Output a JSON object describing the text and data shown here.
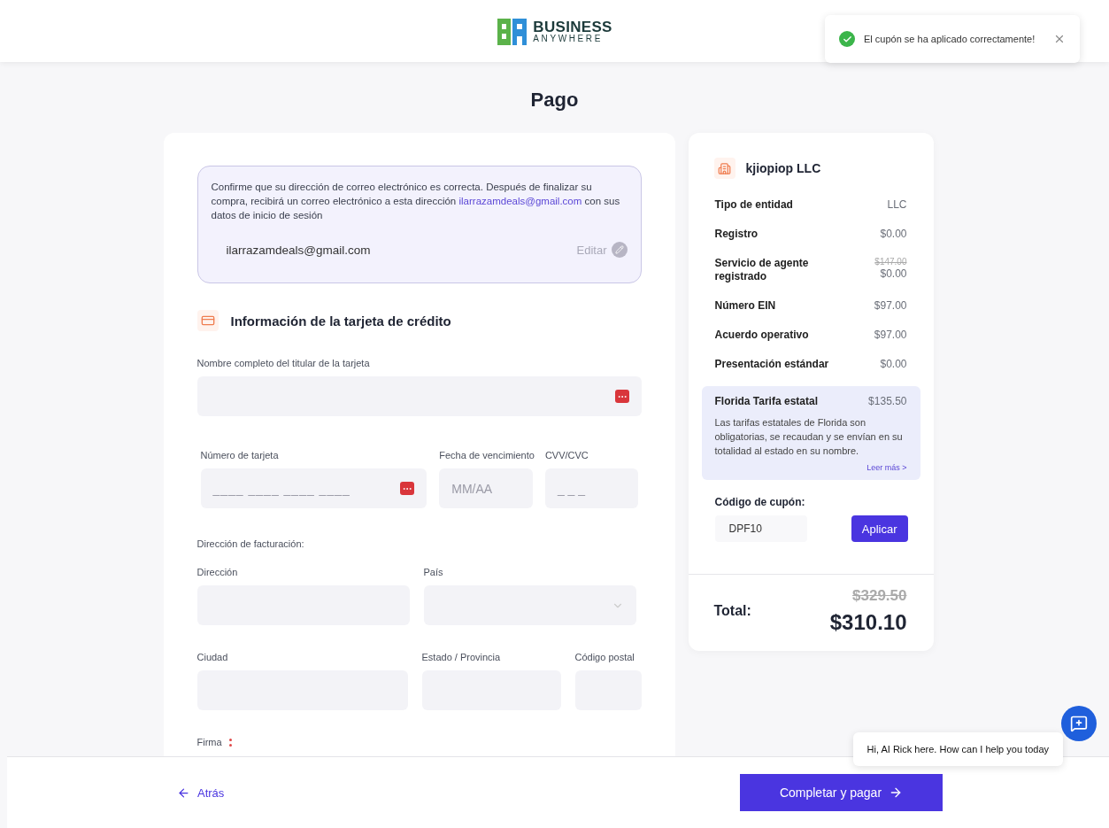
{
  "header": {
    "logo": {
      "line1": "BUSINESS",
      "line2": "ANYWHERE"
    }
  },
  "toast": {
    "kind": "success",
    "message": "El cupón se ha aplicado correctamente!"
  },
  "title": "Pago",
  "email_notice": {
    "text_before": "Confirme que su dirección de correo electrónico es correcta. Después de finalizar su compra, recibirá un correo electrónico a esta dirección",
    "link": "ilarrazamdeals@gmail.com",
    "text_after": "con sus datos de inicio de sesión",
    "email": "ilarrazamdeals@gmail.com",
    "edit_label": "Editar"
  },
  "card_section": {
    "title": "Información de la tarjeta de crédito",
    "holder": {
      "label": "Nombre completo del titular de la tarjeta"
    },
    "number": {
      "label": "Número de tarjeta",
      "placeholder": "____ ____ ____ ____"
    },
    "expiry": {
      "label": "Fecha de vencimiento",
      "placeholder": "MM/AA"
    },
    "cvv": {
      "label": "CVV/CVC",
      "placeholder": "_ _ _"
    }
  },
  "billing": {
    "title": "Dirección de facturación:",
    "rows": [
      [
        {
          "label": "Dirección",
          "kind": "text"
        },
        {
          "label": "País",
          "kind": "select"
        }
      ],
      [
        {
          "label": "Ciudad",
          "kind": "text"
        },
        {
          "label": "Estado / Provincia",
          "kind": "text"
        },
        {
          "label": "Código postal",
          "kind": "text"
        }
      ]
    ],
    "signature_label": "Firma"
  },
  "summary": {
    "company": "kjiopiop LLC",
    "items": [
      {
        "label": "Tipo de entidad",
        "value": "LLC"
      },
      {
        "label": "Registro",
        "value": "$0.00"
      },
      {
        "label": "Servicio de agente registrado",
        "old_value": "$147.00",
        "value": "$0.00"
      },
      {
        "label": "Número EIN",
        "value": "$97.00"
      },
      {
        "label": "Acuerdo operativo",
        "value": "$97.00"
      },
      {
        "label": "Presentación estándar",
        "value": "$0.00"
      }
    ],
    "state_fee": {
      "label": "Florida Tarifa estatal",
      "value": "$135.50",
      "description": "Las tarifas estatales de Florida son obligatorias, se recaudan y se envían en su totalidad al estado en su nombre.",
      "link": "Leer más >"
    },
    "coupon": {
      "label": "Código de cupón:",
      "value": "DPF10",
      "button": "Aplicar"
    },
    "total": {
      "label": "Total:",
      "old_value": "$329.50",
      "value": "$310.10"
    }
  },
  "footer": {
    "back": "Atrás",
    "submit": "Completar y pagar"
  },
  "chat": {
    "message": "Hi, AI Rick here. How can I help you today"
  }
}
